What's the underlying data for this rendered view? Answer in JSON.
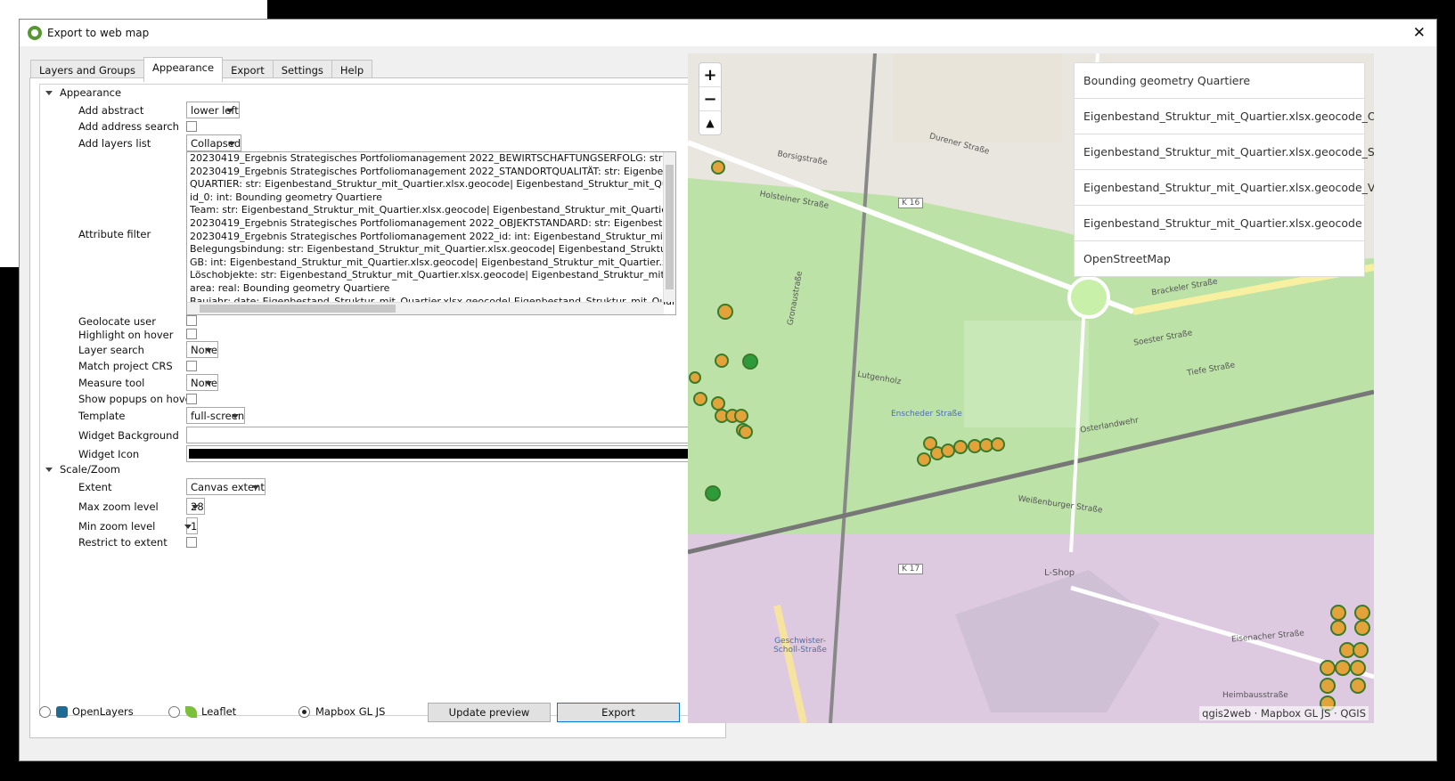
{
  "window": {
    "title": "Export to web map"
  },
  "tabs": [
    "Layers and Groups",
    "Appearance",
    "Export",
    "Settings",
    "Help"
  ],
  "appearance": {
    "group_label": "Appearance",
    "add_abstract": {
      "label": "Add abstract",
      "value": "lower left"
    },
    "add_address_search": {
      "label": "Add address search"
    },
    "add_layers_list": {
      "label": "Add layers list",
      "value": "Collapsed"
    },
    "attribute_filter": {
      "label": "Attribute filter",
      "lines": [
        "20230419_Ergebnis Strategisches Portfoliomanagement 2022_BEWIRTSCHAFTUNGSERFOLG: str: Eigenbest",
        "20230419_Ergebnis Strategisches Portfoliomanagement 2022_STANDORTQUALITÄT: str: Eigenbestand_Stru",
        "QUARTIER: str: Eigenbestand_Struktur_mit_Quartier.xlsx.geocode| Eigenbestand_Struktur_mit_Quartier.xls",
        "id_0: int: Bounding geometry Quartiere",
        "Team: str: Eigenbestand_Struktur_mit_Quartier.xlsx.geocode| Eigenbestand_Struktur_mit_Quartier.xlsx.geo",
        "20230419_Ergebnis Strategisches Portfoliomanagement 2022_OBJEKTSTANDARD: str: Eigenbestand_Strukt",
        "20230419_Ergebnis Strategisches Portfoliomanagement 2022_id: int: Eigenbestand_Struktur_mit_Quartier.x",
        "Belegungsbindung: str: Eigenbestand_Struktur_mit_Quartier.xlsx.geocode| Eigenbestand_Struktur_mit_Qu",
        "GB: int: Eigenbestand_Struktur_mit_Quartier.xlsx.geocode| Eigenbestand_Struktur_mit_Quartier.xlsx.geoc",
        "Löschobjekte: str: Eigenbestand_Struktur_mit_Quartier.xlsx.geocode| Eigenbestand_Struktur_mit_Quartier",
        "area: real: Bounding geometry Quartiere",
        "Baujahr: date: Eigenbestand_Struktur_mit_Quartier.xlsx.geocode| Eigenbestand_Struktur_mit_Quartier.xlsx"
      ]
    },
    "geolocate_user": {
      "label": "Geolocate user"
    },
    "highlight_on_hover": {
      "label": "Highlight on hover"
    },
    "layer_search": {
      "label": "Layer search",
      "value": "None"
    },
    "match_project_crs": {
      "label": "Match project CRS"
    },
    "measure_tool": {
      "label": "Measure tool",
      "value": "None"
    },
    "show_popups_on_hover": {
      "label": "Show popups on hover"
    },
    "template": {
      "label": "Template",
      "value": "full-screen"
    },
    "widget_background": {
      "label": "Widget Background",
      "color": "#ffffff"
    },
    "widget_icon": {
      "label": "Widget Icon",
      "color": "#000000"
    }
  },
  "scale_zoom": {
    "group_label": "Scale/Zoom",
    "extent": {
      "label": "Extent",
      "value": "Canvas extent"
    },
    "max_zoom": {
      "label": "Max zoom level",
      "value": "28"
    },
    "min_zoom": {
      "label": "Min zoom level",
      "value": "1"
    },
    "restrict_to_extent": {
      "label": "Restrict to extent"
    }
  },
  "renderers": {
    "openlayers": "OpenLayers",
    "leaflet": "Leaflet",
    "mapbox": "Mapbox GL JS",
    "selected": "mapbox"
  },
  "buttons": {
    "update_preview": "Update preview",
    "export": "Export"
  },
  "map": {
    "zoom_in": "+",
    "zoom_out": "−",
    "north": "▲",
    "layers": [
      "Bounding geometry Quartiere",
      "Eigenbestand_Struktur_mit_Quartier.xlsx.geocode_OS",
      "Eigenbestand_Struktur_mit_Quartier.xlsx.geocode_SQ",
      "Eigenbestand_Struktur_mit_Quartier.xlsx.geocode_VE",
      "Eigenbestand_Struktur_mit_Quartier.xlsx.geocode",
      "OpenStreetMap"
    ],
    "attribution": "qgis2web · Mapbox GL JS · QGIS",
    "street_labels": [
      "Borsigstraße",
      "Durener Straße",
      "K 16",
      "Brackeler Straße",
      "Soester Straße",
      "Tiefe Straße",
      "Osterlandwehr",
      "Weißenburger Straße",
      "K 17",
      "L-Shop",
      "Holsteiner Straße",
      "Gronaustraße",
      "Lutgenholz",
      "Enscheder Straße",
      "Heimbausstraße",
      "Eisenacher Straße",
      "Geschwister-Scholl-Straße"
    ],
    "colors": {
      "green_zone": "#98e07a",
      "purple_zone": "#d8bfe0"
    }
  }
}
